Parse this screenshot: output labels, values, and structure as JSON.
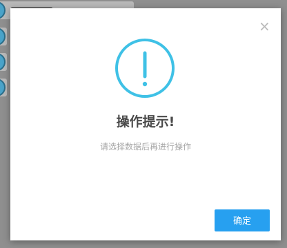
{
  "dialog": {
    "close_glyph": "×",
    "icon": "exclamation-circle-icon",
    "title": "操作提示!",
    "message": "请选择数据后再进行操作",
    "confirm_label": "确定"
  },
  "colors": {
    "accent": "#27a0f0",
    "icon_stroke": "#3fc1e6",
    "title": "#4a4a4a",
    "message": "#a6a6a6",
    "close": "#b8b8b8"
  }
}
